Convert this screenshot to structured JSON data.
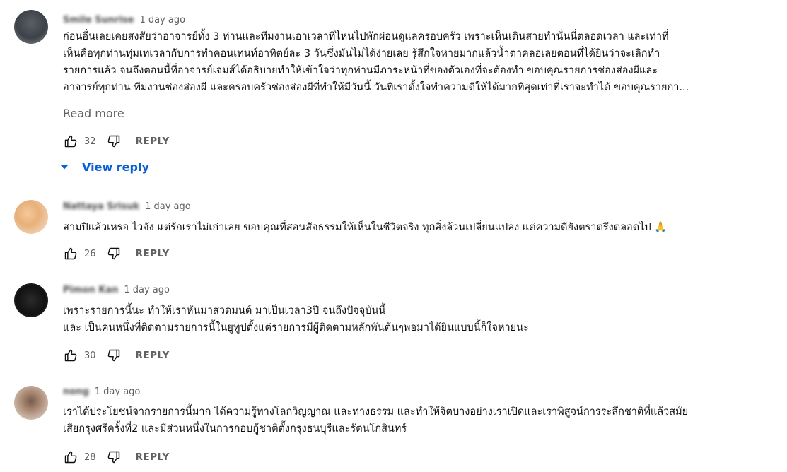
{
  "comments": [
    {
      "author": "Smile Sunrise",
      "time": "1 day ago",
      "lines": [
        "ก่อนอื่นเลยเคยสงสัยว่าอาจารย์ทั้ง 3 ท่านและทีมงานเอาเวลาที่ไหนไปพักผ่อนดูแลครอบครัว เพราะเห็นเดินสายทำนั่นนี่ตลอดเวลา และเท่าที่",
        "เห็นคือทุกท่านทุ่มเทเวลากับการทำคอนเทนท์อาทิตย์ละ 3 วันซึ่งมันไม่ได้ง่ายเลย รู้สึกใจหายมากแล้วน้ำตาคลอเลยตอนที่ได้ยินว่าจะเลิกทำ",
        "รายการแล้ว จนถึงตอนนี้ที่อาจารย์เจมส์ได้อธิบายทำให้เข้าใจว่าทุกท่านมีภาระหน้าที่ของตัวเองที่จะต้องทำ ขอบคุณรายการช่องส่องผีและ",
        "อาจารย์ทุกท่าน ทีมงานช่องส่องผี และครอบครัวช่องส่องผีที่ทำให้มีวันนี้ วันที่เราตั้งใจทำความดีให้ได้มากที่สุดเท่าที่เราจะทำได้ ขอบคุณรายกา..."
      ],
      "read_more": "Read more",
      "likes": "32",
      "reply": "REPLY",
      "view_reply": "View reply"
    },
    {
      "author": "Nattaya Srisuk",
      "time": "1 day ago",
      "lines": [
        "สามปีแล้วเหรอ ไวจัง แต่รักเราไม่เก่าเลย  ขอบคุณที่สอนสัจธรรมให้เห็นในชีวิตจริง ทุกสิ่งล้วนเปลี่ยนแปลง แต่ความดียังตราตรึงตลอดไป 🙏"
      ],
      "likes": "26",
      "reply": "REPLY"
    },
    {
      "author": "Pimon Kan",
      "time": "1 day ago",
      "lines": [
        "เพราะรายการนี้นะ ทำให้เราหันมาสวดมนต์ มาเป็นเวลา3ปี จนถึงปัจจุบันนี้",
        "และ เป็นคนหนึ่งที่ติดตามรายการนี้ในยูทูปตั้งแต่รายการมีผู้ติดตามหลักพันต้นๆพอมาได้ยินแบบนี้ก็ใจหายนะ"
      ],
      "likes": "30",
      "reply": "REPLY"
    },
    {
      "author": "nong",
      "time": "1 day ago",
      "lines": [
        "เราได้ประโยชน์จากรายการนี้มาก ได้ความรู้ทางโลกวิญญาณ และทางธรรม และทำให้จิตบางอย่างเราเปิดและเราพิสูจน์การระลึกชาติที่แล้วสมัย",
        "เสียกรุงศรีครั้งที่2 และมีส่วนหนึ่งในการกอบกู้ชาติตั้งกรุงธนบุรีและรัตนโกสินทร์"
      ],
      "likes": "28",
      "reply": "REPLY"
    }
  ],
  "icons": {
    "like": "thumb-up-outline-icon",
    "dislike": "thumb-down-outline-icon",
    "caret": "caret-down-icon"
  },
  "colors": {
    "link_blue": "#065fd4",
    "meta_gray": "#606060",
    "text": "#0f0f0f"
  }
}
